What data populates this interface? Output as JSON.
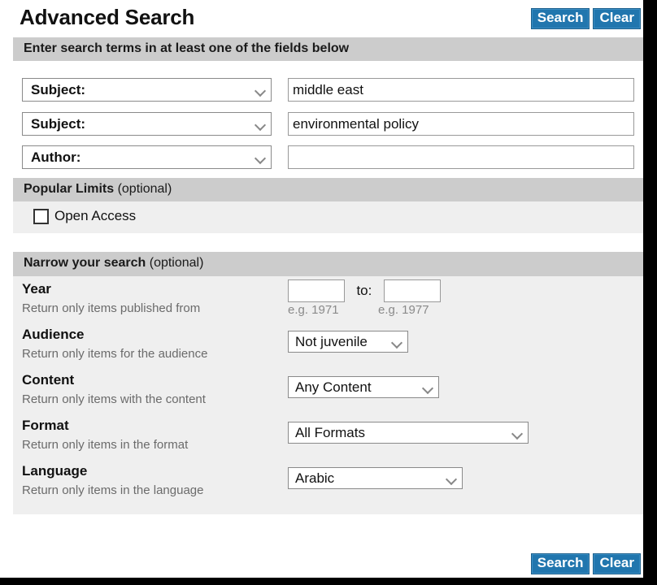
{
  "header": {
    "title": "Advanced Search",
    "search_label": "Search",
    "clear_label": "Clear"
  },
  "footer": {
    "search_label": "Search",
    "clear_label": "Clear"
  },
  "search_section": {
    "bar_title": "Enter search terms in at least one of the fields below",
    "rows": [
      {
        "field_label": "Subject:",
        "value": "middle east",
        "placeholder": ""
      },
      {
        "field_label": "Subject:",
        "value": "environmental policy",
        "placeholder": ""
      },
      {
        "field_label": "Author:",
        "value": "",
        "placeholder": ""
      }
    ]
  },
  "popular_limits": {
    "bar_title": "Popular Limits",
    "bar_optional": "(optional)",
    "open_access_label": "Open Access",
    "open_access_checked": false
  },
  "narrow": {
    "bar_title": "Narrow your search",
    "bar_optional": "(optional)",
    "year": {
      "label": "Year",
      "sublabel": "Return only items published from",
      "from_value": "",
      "to_label": "to:",
      "to_value": "",
      "from_hint": "e.g. 1971",
      "to_hint": "e.g. 1977"
    },
    "audience": {
      "label": "Audience",
      "sublabel": "Return only items for the audience",
      "value": "Not juvenile"
    },
    "content": {
      "label": "Content",
      "sublabel": "Return only items with the content",
      "value": "Any Content"
    },
    "format": {
      "label": "Format",
      "sublabel": "Return only items in the format",
      "value": "All Formats"
    },
    "language": {
      "label": "Language",
      "sublabel": "Return only items in the language",
      "value": "Arabic"
    }
  },
  "colors": {
    "button_blue": "#2176ae",
    "section_bar_gray": "#cccccc",
    "body_gray": "#efefef"
  }
}
